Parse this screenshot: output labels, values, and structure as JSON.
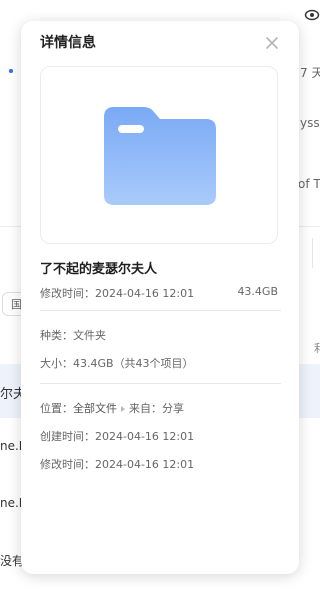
{
  "background": {
    "row1_tail": "7 天",
    "row2_tail": "yss c",
    "row3_tail": "of T",
    "pill": "国",
    "rows": [
      "尔夫",
      "ne.L",
      "ne.L",
      "没有"
    ],
    "right_tail": "利"
  },
  "modal": {
    "title": "详情信息",
    "file_name": "了不起的麦瑟尔夫人",
    "modified_label": "修改时间：",
    "modified_value": "2024-04-16 12:01",
    "size_right": "43.4GB",
    "kind_label": "种类：",
    "kind_value": "文件夹",
    "size_label": "大小：",
    "size_value": "43.4GB（共43个项目）",
    "location_label": "位置：",
    "location_value": "全部文件",
    "source_label": "来自：",
    "source_value": "分享",
    "created_label": "创建时间：",
    "created_value": "2024-04-16 12:01",
    "modified2_label": "修改时间：",
    "modified2_value": "2024-04-16 12:01"
  },
  "icons": {
    "close": "close-icon",
    "folder": "folder-icon",
    "eye": "eye-icon"
  },
  "colors": {
    "folder_top": "#7aa9f5",
    "folder_bottom": "#a9cbfb",
    "accent_dot": "#2d6df6"
  }
}
